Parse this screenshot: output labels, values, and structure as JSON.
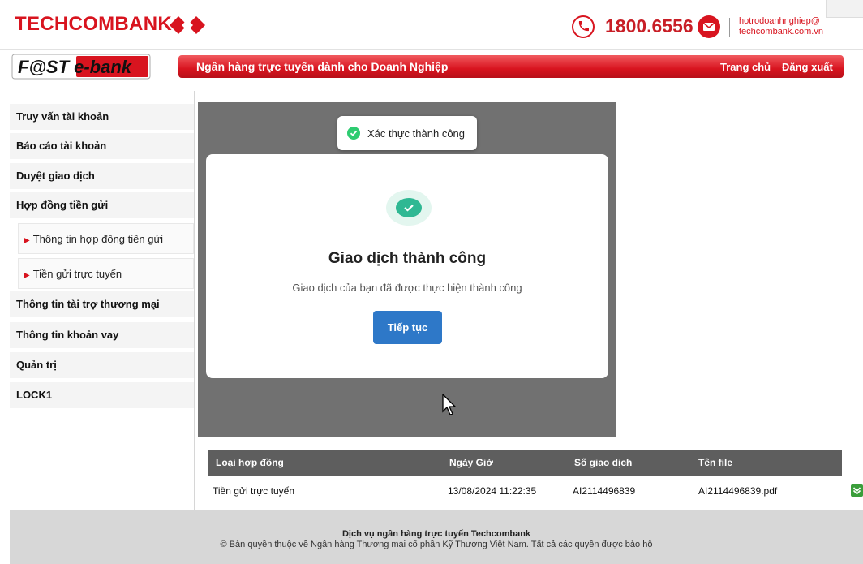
{
  "header": {
    "brand": "TECHCOMBANK",
    "hotline": "1800.6556",
    "email_line1": "hotrodoanhnghiep@",
    "email_line2": "techcombank.com.vn"
  },
  "banner": {
    "logo_text": "F@ST e-bank",
    "title": "Ngân hàng trực tuyến dành cho Doanh Nghiệp",
    "home_link": "Trang chủ",
    "logout_link": "Đăng xuất"
  },
  "sidebar": {
    "items": [
      {
        "label": "Truy vấn tài khoản"
      },
      {
        "label": "Báo cáo tài khoản"
      },
      {
        "label": "Duyệt giao dịch"
      },
      {
        "label": "Hợp đồng tiền gửi"
      },
      {
        "label": "Thông tin hợp đồng tiền gửi"
      },
      {
        "label": "Tiền gửi trực tuyến"
      },
      {
        "label": "Thông tin tài trợ thương mại"
      },
      {
        "label": "Thông tin khoản vay"
      },
      {
        "label": "Quản trị"
      },
      {
        "label": "LOCK1"
      }
    ]
  },
  "toast": {
    "text": "Xác thực thành công"
  },
  "modal": {
    "title": "Giao dịch thành công",
    "description": "Giao dịch của bạn đã được thực hiện thành công",
    "button": "Tiếp tục"
  },
  "table": {
    "columns": [
      "Loại hợp đồng",
      "Ngày Giờ",
      "Số giao dịch",
      "Tên file"
    ],
    "rows": [
      [
        "Tiền gửi trực tuyến",
        "13/08/2024 11:22:35",
        "AI2114496839",
        "AI2114496839.pdf"
      ]
    ]
  },
  "footer": {
    "line1": "Dịch vụ ngân hàng trực tuyến Techcombank",
    "line2": "© Bản quyền thuộc về Ngân hàng Thương mại cổ phần Kỹ Thương Việt Nam. Tất cả các quyền được bảo hộ"
  },
  "colors": {
    "brand_red": "#d8141f",
    "button_blue": "#2e78c8",
    "success_green": "#2fb893"
  }
}
